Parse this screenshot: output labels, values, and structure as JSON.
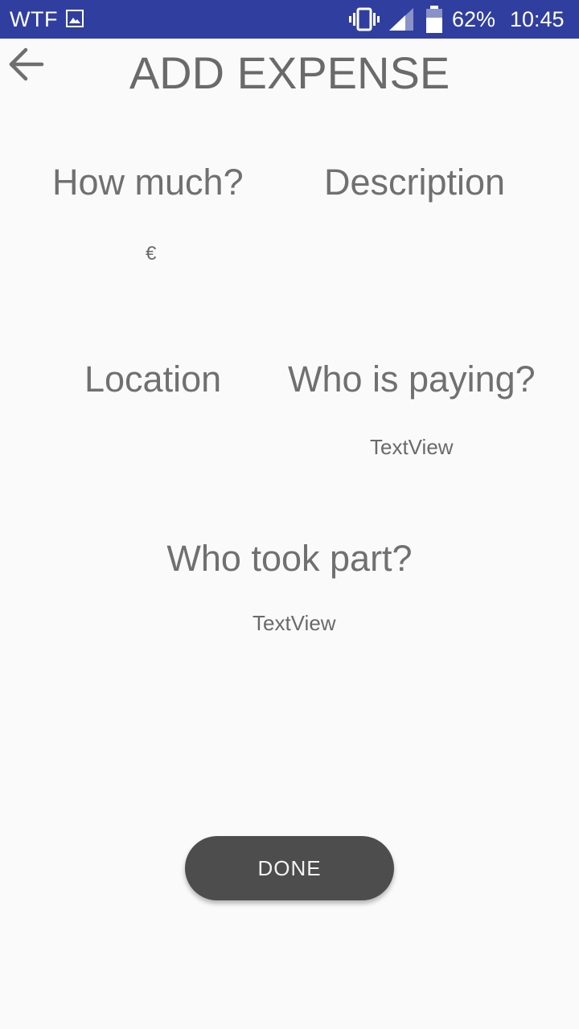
{
  "status_bar": {
    "carrier": "WTF",
    "battery_percent": "62%",
    "time": "10:45",
    "icons": [
      "image-icon",
      "vibrate-icon",
      "signal-icon",
      "battery-icon"
    ],
    "background_color": "#303f9f"
  },
  "header": {
    "back_icon": "arrow-back-icon",
    "title": "ADD EXPENSE"
  },
  "form": {
    "amount": {
      "label": "How much?",
      "currency_symbol": "€",
      "value": ""
    },
    "description": {
      "label": "Description",
      "value": ""
    },
    "location": {
      "label": "Location",
      "value": ""
    },
    "payer": {
      "label": "Who is paying?",
      "value": "TextView"
    },
    "participants": {
      "label": "Who took part?",
      "value": "TextView"
    }
  },
  "actions": {
    "done_label": "DONE",
    "done_color": "#4d4d4d"
  }
}
